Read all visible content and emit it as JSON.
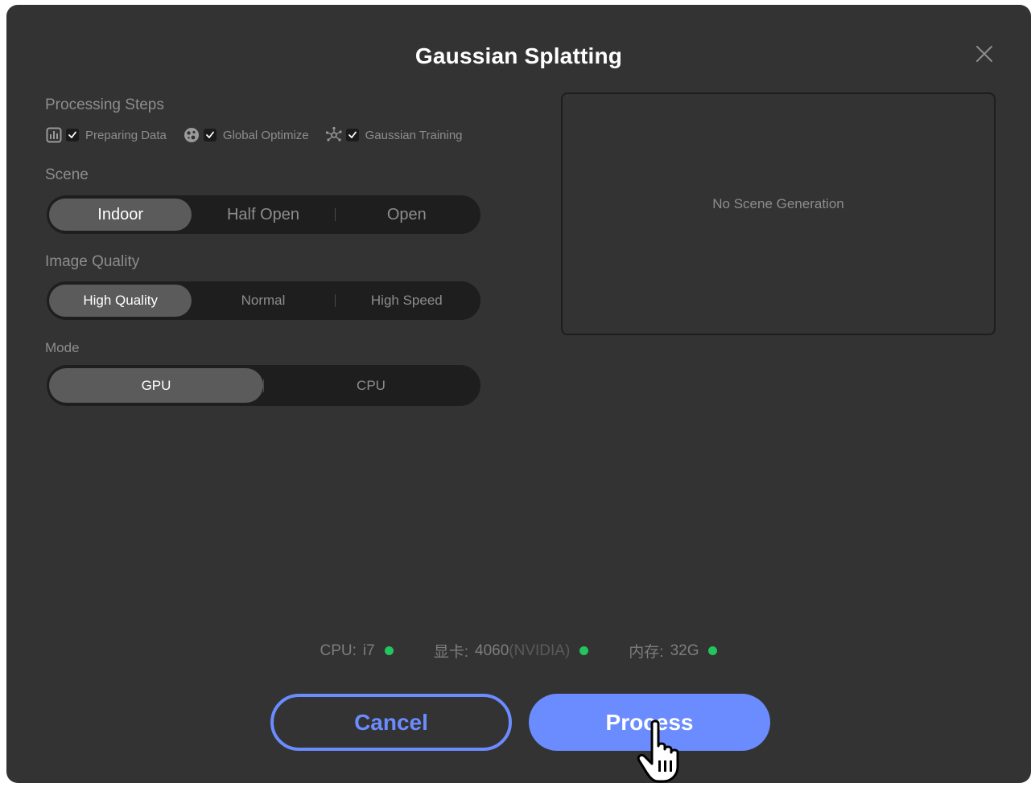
{
  "dialog": {
    "title": "Gaussian Splatting",
    "close_icon": "close-icon"
  },
  "processing_steps": {
    "label": "Processing Steps",
    "items": [
      {
        "label": "Preparing Data",
        "icon": "chart-icon",
        "checked": true
      },
      {
        "label": "Global Optimize",
        "icon": "globe-icon",
        "checked": true
      },
      {
        "label": "Gaussian Training",
        "icon": "network-icon",
        "checked": true
      }
    ]
  },
  "scene": {
    "label": "Scene",
    "options": [
      "Indoor",
      "Half Open",
      "Open"
    ],
    "selected": "Indoor"
  },
  "image_quality": {
    "label": "Image Quality",
    "options": [
      "High Quality",
      "Normal",
      "High Speed"
    ],
    "selected": "High Quality"
  },
  "mode": {
    "label": "Mode",
    "options": [
      "GPU",
      "CPU"
    ],
    "selected": "GPU"
  },
  "preview": {
    "text": "No Scene Generation"
  },
  "system_info": {
    "cpu": {
      "label": "CPU:",
      "value": "i7"
    },
    "gpu": {
      "label": "显卡:",
      "value": "4060",
      "vendor": "(NVIDIA)"
    },
    "memory": {
      "label": "内存:",
      "value": "32G"
    },
    "status_color": "#22c55e"
  },
  "buttons": {
    "cancel": "Cancel",
    "process": "Process"
  },
  "colors": {
    "accent": "#6b8cff",
    "background": "#333333"
  }
}
